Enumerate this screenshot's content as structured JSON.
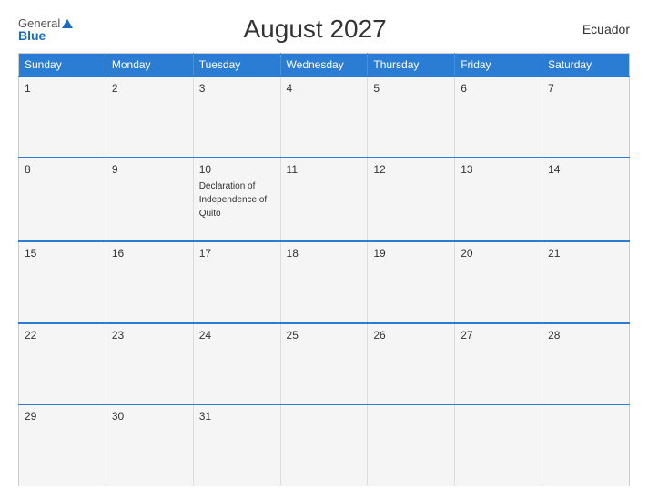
{
  "header": {
    "logo_general": "General",
    "logo_blue": "Blue",
    "title": "August 2027",
    "country": "Ecuador"
  },
  "weekdays": [
    "Sunday",
    "Monday",
    "Tuesday",
    "Wednesday",
    "Thursday",
    "Friday",
    "Saturday"
  ],
  "weeks": [
    [
      {
        "day": "1",
        "event": ""
      },
      {
        "day": "2",
        "event": ""
      },
      {
        "day": "3",
        "event": ""
      },
      {
        "day": "4",
        "event": ""
      },
      {
        "day": "5",
        "event": ""
      },
      {
        "day": "6",
        "event": ""
      },
      {
        "day": "7",
        "event": ""
      }
    ],
    [
      {
        "day": "8",
        "event": ""
      },
      {
        "day": "9",
        "event": ""
      },
      {
        "day": "10",
        "event": "Declaration of Independence of Quito"
      },
      {
        "day": "11",
        "event": ""
      },
      {
        "day": "12",
        "event": ""
      },
      {
        "day": "13",
        "event": ""
      },
      {
        "day": "14",
        "event": ""
      }
    ],
    [
      {
        "day": "15",
        "event": ""
      },
      {
        "day": "16",
        "event": ""
      },
      {
        "day": "17",
        "event": ""
      },
      {
        "day": "18",
        "event": ""
      },
      {
        "day": "19",
        "event": ""
      },
      {
        "day": "20",
        "event": ""
      },
      {
        "day": "21",
        "event": ""
      }
    ],
    [
      {
        "day": "22",
        "event": ""
      },
      {
        "day": "23",
        "event": ""
      },
      {
        "day": "24",
        "event": ""
      },
      {
        "day": "25",
        "event": ""
      },
      {
        "day": "26",
        "event": ""
      },
      {
        "day": "27",
        "event": ""
      },
      {
        "day": "28",
        "event": ""
      }
    ],
    [
      {
        "day": "29",
        "event": ""
      },
      {
        "day": "30",
        "event": ""
      },
      {
        "day": "31",
        "event": ""
      },
      {
        "day": "",
        "event": ""
      },
      {
        "day": "",
        "event": ""
      },
      {
        "day": "",
        "event": ""
      },
      {
        "day": "",
        "event": ""
      }
    ]
  ]
}
